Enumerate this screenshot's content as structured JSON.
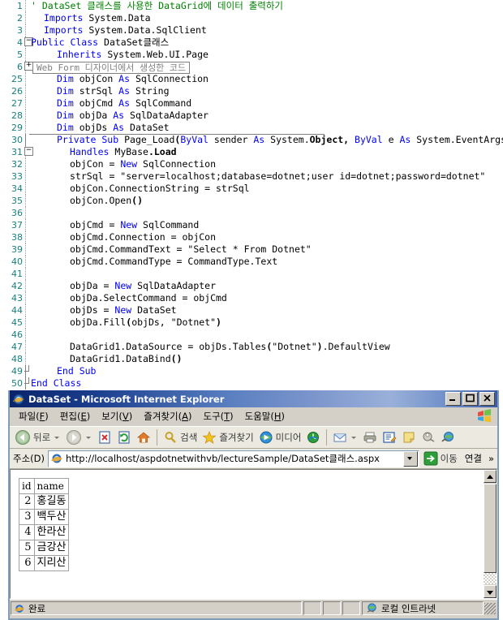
{
  "editor": {
    "name": "visual-basic-code-editor",
    "lines": [
      {
        "num": "1",
        "indent": 0,
        "marker": "",
        "tokens": [
          {
            "t": "' DataSet 클래스를 사용한 DataGrid에 데이터 출력하기",
            "c": "cmt"
          }
        ]
      },
      {
        "num": "2",
        "indent": 1,
        "marker": "",
        "tokens": [
          {
            "t": "Imports",
            "c": "kw"
          },
          {
            "t": " System.Data",
            "c": ""
          }
        ]
      },
      {
        "num": "3",
        "indent": 1,
        "marker": "",
        "tokens": [
          {
            "t": "Imports",
            "c": "kw"
          },
          {
            "t": " System.Data.SqlClient",
            "c": ""
          }
        ]
      },
      {
        "num": "4",
        "indent": 0,
        "marker": "minus",
        "tokens": [
          {
            "t": "Public Class",
            "c": "kw"
          },
          {
            "t": " DataSet클래스",
            "c": ""
          }
        ]
      },
      {
        "num": "5",
        "indent": 2,
        "marker": "",
        "tokens": [
          {
            "t": "Inherits",
            "c": "kw"
          },
          {
            "t": " System.Web.UI.Page",
            "c": ""
          }
        ]
      },
      {
        "num": "6",
        "indent": 0,
        "marker": "plus",
        "region": "Web Form 디자이너에서 생성한 코드",
        "tokens": []
      },
      {
        "num": "25",
        "indent": 2,
        "marker": "",
        "tokens": [
          {
            "t": "Dim",
            "c": "kw"
          },
          {
            "t": " objCon ",
            "c": ""
          },
          {
            "t": "As",
            "c": "kw"
          },
          {
            "t": " SqlConnection",
            "c": ""
          }
        ]
      },
      {
        "num": "26",
        "indent": 2,
        "marker": "",
        "tokens": [
          {
            "t": "Dim",
            "c": "kw"
          },
          {
            "t": " strSql ",
            "c": ""
          },
          {
            "t": "As",
            "c": "kw"
          },
          {
            "t": " String",
            "c": ""
          }
        ]
      },
      {
        "num": "27",
        "indent": 2,
        "marker": "",
        "tokens": [
          {
            "t": "Dim",
            "c": "kw"
          },
          {
            "t": " objCmd ",
            "c": ""
          },
          {
            "t": "As",
            "c": "kw"
          },
          {
            "t": " SqlCommand",
            "c": ""
          }
        ]
      },
      {
        "num": "28",
        "indent": 2,
        "marker": "",
        "tokens": [
          {
            "t": "Dim",
            "c": "kw"
          },
          {
            "t": " objDa ",
            "c": ""
          },
          {
            "t": "As",
            "c": "kw"
          },
          {
            "t": " SqlDataAdapter",
            "c": ""
          }
        ]
      },
      {
        "num": "29",
        "indent": 2,
        "marker": "",
        "tokens": [
          {
            "t": "Dim",
            "c": "kw"
          },
          {
            "t": " objDs ",
            "c": ""
          },
          {
            "t": "As",
            "c": "kw"
          },
          {
            "t": " DataSet",
            "c": ""
          }
        ]
      },
      {
        "num": "30",
        "indent": 2,
        "marker": "rule",
        "tokens": [
          {
            "t": "Private Sub",
            "c": "kw"
          },
          {
            "t": " Page_Load",
            "c": ""
          },
          {
            "t": "(",
            "c": "bold"
          },
          {
            "t": "ByVal",
            "c": "kw"
          },
          {
            "t": " sender ",
            "c": ""
          },
          {
            "t": "As",
            "c": "kw"
          },
          {
            "t": " System.",
            "c": ""
          },
          {
            "t": "Object",
            "c": "bold"
          },
          {
            "t": ", ",
            "c": "bold"
          },
          {
            "t": "ByVal",
            "c": "kw"
          },
          {
            "t": " e ",
            "c": ""
          },
          {
            "t": "As",
            "c": "kw"
          },
          {
            "t": " System.EventArgs",
            "c": ""
          },
          {
            "t": ")",
            "c": "bold"
          },
          {
            "t": " _",
            "c": ""
          }
        ]
      },
      {
        "num": "31",
        "indent": 3,
        "marker": "minus",
        "tokens": [
          {
            "t": "Handles",
            "c": "kw"
          },
          {
            "t": " MyBase",
            "c": ""
          },
          {
            "t": ".Load",
            "c": "bold"
          }
        ]
      },
      {
        "num": "32",
        "indent": 3,
        "marker": "",
        "tokens": [
          {
            "t": "objCon = ",
            "c": ""
          },
          {
            "t": "New",
            "c": "kw"
          },
          {
            "t": " SqlConnection",
            "c": ""
          }
        ]
      },
      {
        "num": "33",
        "indent": 3,
        "marker": "",
        "tokens": [
          {
            "t": "strSql = \"server=localhost;database=dotnet;user id=dotnet;password=dotnet\"",
            "c": ""
          }
        ]
      },
      {
        "num": "34",
        "indent": 3,
        "marker": "",
        "tokens": [
          {
            "t": "objCon.ConnectionString = strSql",
            "c": ""
          }
        ]
      },
      {
        "num": "35",
        "indent": 3,
        "marker": "",
        "tokens": [
          {
            "t": "objCon.Open",
            "c": ""
          },
          {
            "t": "()",
            "c": "bold"
          }
        ]
      },
      {
        "num": "36",
        "indent": 3,
        "marker": "",
        "tokens": []
      },
      {
        "num": "37",
        "indent": 3,
        "marker": "",
        "tokens": [
          {
            "t": "objCmd = ",
            "c": ""
          },
          {
            "t": "New",
            "c": "kw"
          },
          {
            "t": " SqlCommand",
            "c": ""
          }
        ]
      },
      {
        "num": "38",
        "indent": 3,
        "marker": "",
        "tokens": [
          {
            "t": "objCmd.Connection = objCon",
            "c": ""
          }
        ]
      },
      {
        "num": "39",
        "indent": 3,
        "marker": "",
        "tokens": [
          {
            "t": "objCmd.CommandText = \"Select * From Dotnet\"",
            "c": ""
          }
        ]
      },
      {
        "num": "40",
        "indent": 3,
        "marker": "",
        "tokens": [
          {
            "t": "objCmd.CommandType = CommandType.Text",
            "c": ""
          }
        ]
      },
      {
        "num": "41",
        "indent": 3,
        "marker": "",
        "tokens": []
      },
      {
        "num": "42",
        "indent": 3,
        "marker": "",
        "tokens": [
          {
            "t": "objDa = ",
            "c": ""
          },
          {
            "t": "New",
            "c": "kw"
          },
          {
            "t": " SqlDataAdapter",
            "c": ""
          }
        ]
      },
      {
        "num": "43",
        "indent": 3,
        "marker": "",
        "tokens": [
          {
            "t": "objDa.SelectCommand = objCmd",
            "c": ""
          }
        ]
      },
      {
        "num": "44",
        "indent": 3,
        "marker": "",
        "tokens": [
          {
            "t": "objDs = ",
            "c": ""
          },
          {
            "t": "New",
            "c": "kw"
          },
          {
            "t": " DataSet",
            "c": ""
          }
        ]
      },
      {
        "num": "45",
        "indent": 3,
        "marker": "",
        "tokens": [
          {
            "t": "objDa.Fill",
            "c": ""
          },
          {
            "t": "(",
            "c": "bold"
          },
          {
            "t": "objDs, \"Dotnet\"",
            "c": ""
          },
          {
            "t": ")",
            "c": "bold"
          }
        ]
      },
      {
        "num": "46",
        "indent": 3,
        "marker": "",
        "tokens": []
      },
      {
        "num": "47",
        "indent": 3,
        "marker": "",
        "tokens": [
          {
            "t": "DataGrid1.DataSource = objDs.Tables",
            "c": ""
          },
          {
            "t": "(",
            "c": "bold"
          },
          {
            "t": "\"Dotnet\"",
            "c": ""
          },
          {
            "t": ")",
            "c": "bold"
          },
          {
            "t": ".DefaultView",
            "c": ""
          }
        ]
      },
      {
        "num": "48",
        "indent": 3,
        "marker": "",
        "tokens": [
          {
            "t": "DataGrid1.DataBind",
            "c": ""
          },
          {
            "t": "()",
            "c": "bold"
          }
        ]
      },
      {
        "num": "49",
        "indent": 2,
        "marker": "endsub",
        "tokens": [
          {
            "t": "End Sub",
            "c": "kw"
          }
        ]
      },
      {
        "num": "50",
        "indent": 0,
        "marker": "endclass",
        "tokens": [
          {
            "t": "End Class",
            "c": "kw"
          }
        ]
      }
    ]
  },
  "browser": {
    "title": "DataSet - Microsoft Internet Explorer",
    "window_buttons": [
      {
        "name": "minimize-button",
        "glyph": "_"
      },
      {
        "name": "maximize-button",
        "glyph": "❐"
      },
      {
        "name": "close-button",
        "glyph": "✕"
      }
    ],
    "menu": [
      {
        "name": "menu-file",
        "pre": "파일(",
        "key": "F",
        "post": ")"
      },
      {
        "name": "menu-edit",
        "pre": "편집(",
        "key": "E",
        "post": ")"
      },
      {
        "name": "menu-view",
        "pre": "보기(",
        "key": "V",
        "post": ")"
      },
      {
        "name": "menu-favorites",
        "pre": "즐겨찾기(",
        "key": "A",
        "post": ")"
      },
      {
        "name": "menu-tools",
        "pre": "도구(",
        "key": "T",
        "post": ")"
      },
      {
        "name": "menu-help",
        "pre": "도움말(",
        "key": "H",
        "post": ")"
      }
    ],
    "toolbar": {
      "back_label": "뒤로",
      "search_label": "검색",
      "favorites_label": "즐겨찾기",
      "media_label": "미디어"
    },
    "address": {
      "label": "주소(D)",
      "url": "http://localhost/aspdotnetwithvb/lectureSample/DataSet클래스.aspx",
      "go_label": "이동",
      "links_label": "연결",
      "overflow_glyph": "»"
    },
    "page": {
      "grid": {
        "columns": [
          "id",
          "name"
        ],
        "rows": [
          [
            "2",
            "홍길동"
          ],
          [
            "3",
            "백두산"
          ],
          [
            "4",
            "한라산"
          ],
          [
            "5",
            "금강산"
          ],
          [
            "6",
            "지리산"
          ]
        ]
      }
    },
    "status": {
      "text": "완료",
      "zone": "로컬 인트라넷"
    }
  },
  "colors": {
    "title_active": "#0a246a",
    "keyword": "#0000ff",
    "comment": "#008000",
    "linenum": "#17807e",
    "chrome": "#d4d0c8",
    "toolbar": "#ebe9e0"
  }
}
